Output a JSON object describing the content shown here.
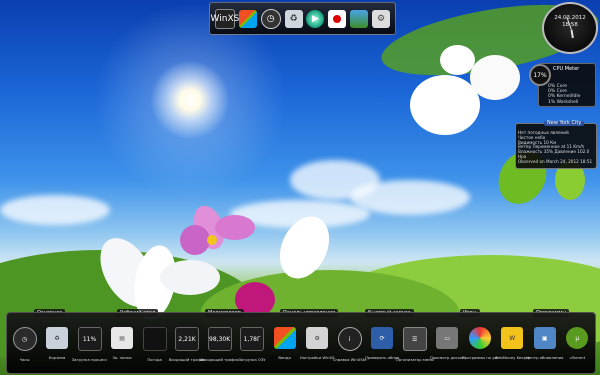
{
  "top_dock": {
    "icons": [
      "winlogo-icon",
      "windows-flag-icon",
      "clock-icon",
      "recycle-bin-icon",
      "media-player-icon",
      "japan-flag-icon",
      "photo-icon",
      "gear-icon"
    ],
    "label_first": "WinXS"
  },
  "clock": {
    "date": "24.03.2012",
    "time": "18:58"
  },
  "cpu_meter": {
    "percent": "17%",
    "title": "CPU Meter",
    "lines": [
      "0% Core",
      "0% Core",
      "0% Kernel/Idle",
      "1% Workshell"
    ]
  },
  "weather": {
    "city": "New York City",
    "lines": [
      "Нет погодных явлений",
      "Чистое небо",
      "Видимость 10 Км",
      "Ветер Переменное at 11 Km/h",
      "Влажность 35% Давление 102.0 Hpa",
      "Observed on March 24, 2012 18:51"
    ]
  },
  "bottom_tabs": [
    "Основное",
    "Рабочий стол",
    "Медиаплеер",
    "Панель управления",
    "Быстрый запуск",
    "Игры",
    "Программы"
  ],
  "bottom_items": [
    {
      "label": "Часы",
      "icon": "clock-icon",
      "value": ""
    },
    {
      "label": "Корзина",
      "icon": "recycle-bin-icon",
      "value": ""
    },
    {
      "label": "Загрузка процесс",
      "icon": "cpu-meter-icon",
      "value": "11%"
    },
    {
      "label": "За. папка",
      "icon": "folder-icon",
      "value": ""
    },
    {
      "label": "Погода",
      "icon": "weather-icon",
      "value": ""
    },
    {
      "label": "Входящий трафик",
      "icon": "download-traffic-icon",
      "value": "2,21K"
    },
    {
      "label": "Исходящий трафик",
      "icon": "upload-traffic-icon",
      "value": "98,30K"
    },
    {
      "label": "Загрузка ОЗУ",
      "icon": "ram-icon",
      "value": "1,78Г"
    },
    {
      "label": "Винда",
      "icon": "windows-flag-icon",
      "value": ""
    },
    {
      "label": "Настройки WinXS",
      "icon": "settings-icon",
      "value": ""
    },
    {
      "label": "Справка WinXSte",
      "icon": "info-icon",
      "value": ""
    },
    {
      "label": "Проверить обнов",
      "icon": "update-icon",
      "value": ""
    },
    {
      "label": "Организатор меню",
      "icon": "menu-organizer-icon",
      "value": ""
    },
    {
      "label": "Просмотр дисков",
      "icon": "disk-icon",
      "value": ""
    },
    {
      "label": "Программы по ум",
      "icon": "default-programs-icon",
      "value": ""
    },
    {
      "label": "WebMoney Keeper",
      "icon": "webmoney-icon",
      "value": ""
    },
    {
      "label": "Центр обновления",
      "icon": "windows-update-icon",
      "value": ""
    },
    {
      "label": "uTorrent",
      "icon": "utorrent-icon",
      "value": ""
    }
  ]
}
